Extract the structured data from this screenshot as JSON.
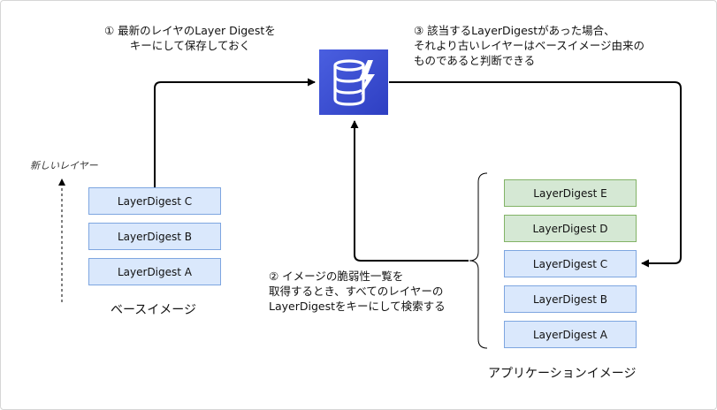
{
  "notes": {
    "step1": [
      "① 最新のレイヤのLayer Digestを",
      "キーにして保存しておく"
    ],
    "step2": [
      "② イメージの脆弱性一覧を",
      "取得するとき、すべてのレイヤーの",
      "LayerDigestをキーにして検索する"
    ],
    "step3": [
      "③ 該当するLayerDigestがあった場合、",
      "それより古いレイヤーはベースイメージ由来の",
      "ものであると判断できる"
    ]
  },
  "base_image": {
    "label": "ベースイメージ",
    "hint": "新しいレイヤー",
    "layers": [
      "LayerDigest C",
      "LayerDigest B",
      "LayerDigest A"
    ]
  },
  "app_image": {
    "label": "アプリケーションイメージ",
    "layers": [
      "LayerDigest E",
      "LayerDigest D",
      "LayerDigest C",
      "LayerDigest B",
      "LayerDigest A"
    ]
  },
  "icons": {
    "database": "dynamodb-database-icon"
  },
  "colors": {
    "base_layer_fill": "#dae8fc",
    "base_layer_stroke": "#7ea6e0",
    "new_layer_fill": "#d5e8d4",
    "new_layer_stroke": "#82b366",
    "db_icon": "#3b4ed6"
  }
}
